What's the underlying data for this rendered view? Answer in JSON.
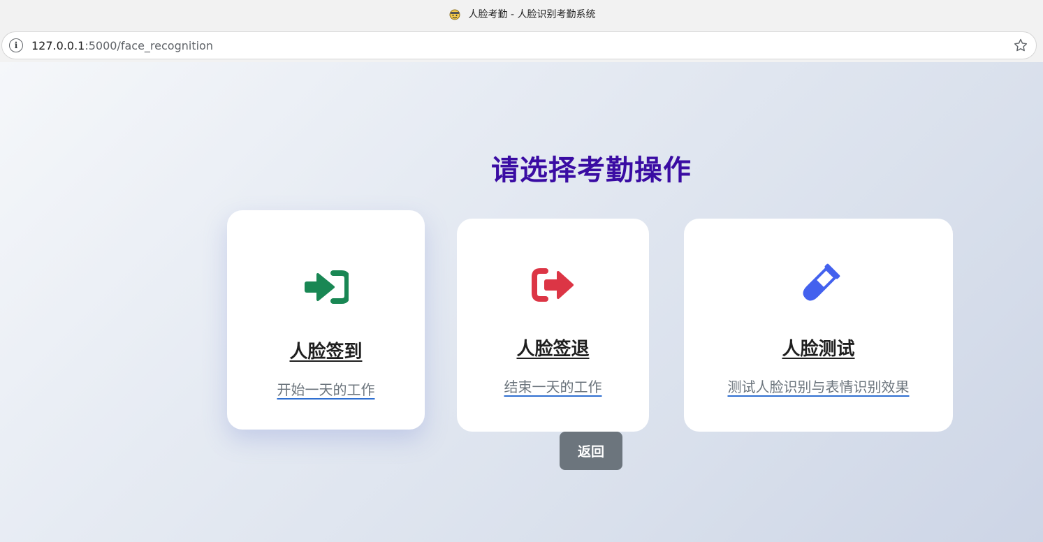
{
  "browser": {
    "tab_title": "人脸考勤 - 人脸识别考勤系统",
    "url_host": "127.0.0.1",
    "url_rest": ":5000/face_recognition"
  },
  "page": {
    "title": "请选择考勤操作",
    "back_label": "返回"
  },
  "cards": [
    {
      "title": "人脸签到",
      "desc": "开始一天的工作",
      "icon": "sign-in-icon",
      "color": "#198754"
    },
    {
      "title": "人脸签退",
      "desc": "结束一天的工作",
      "icon": "sign-out-icon",
      "color": "#dc3545"
    },
    {
      "title": "人脸测试",
      "desc": "测试人脸识别与表情识别效果",
      "icon": "test-tube-icon",
      "color": "#4361ee"
    }
  ],
  "colors": {
    "title": "#3a0ca3",
    "back_button": "#6c757d"
  }
}
